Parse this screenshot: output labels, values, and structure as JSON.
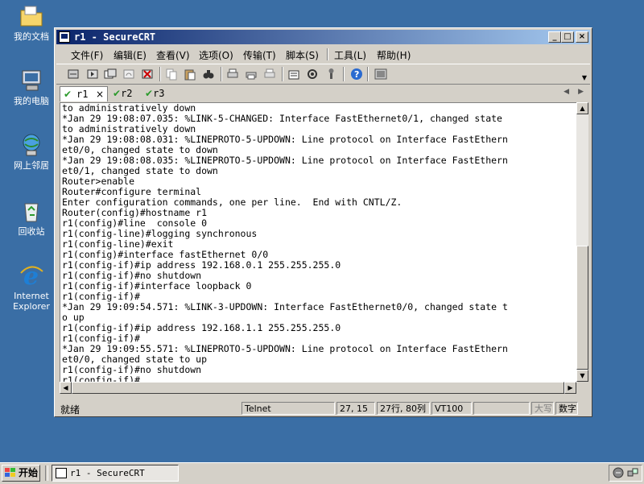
{
  "desktop": {
    "icons": [
      {
        "label": "我的文档",
        "icon": "folder-icon"
      },
      {
        "label": "我的电脑",
        "icon": "computer-icon"
      },
      {
        "label": "网上邻居",
        "icon": "network-icon"
      },
      {
        "label": "回收站",
        "icon": "recycle-bin-icon"
      },
      {
        "label": "Internet Explorer",
        "icon": "ie-icon"
      }
    ]
  },
  "window": {
    "title": "r1 - SecureCRT",
    "controls": {
      "minimize": "_",
      "maximize": "□",
      "close": "×"
    }
  },
  "menu": [
    "文件(F)",
    "编辑(E)",
    "查看(V)",
    "选项(O)",
    "传输(T)",
    "脚本(S)",
    "工具(L)",
    "帮助(H)"
  ],
  "tabs": [
    {
      "label": "r1",
      "active": true,
      "close": "×"
    },
    {
      "label": "r2",
      "active": false
    },
    {
      "label": "r3",
      "active": false
    }
  ],
  "tab_nav": {
    "prev": "◀",
    "next": "▶"
  },
  "terminal": {
    "lines": [
      "to administratively down",
      "*Jan 29 19:08:07.035: %LINK-5-CHANGED: Interface FastEthernet0/1, changed state",
      "to administratively down",
      "*Jan 29 19:08:08.031: %LINEPROTO-5-UPDOWN: Line protocol on Interface FastEthern",
      "et0/0, changed state to down",
      "*Jan 29 19:08:08.035: %LINEPROTO-5-UPDOWN: Line protocol on Interface FastEthern",
      "et0/1, changed state to down",
      "Router>enable",
      "Router#configure terminal",
      "Enter configuration commands, one per line.  End with CNTL/Z.",
      "Router(config)#hostname r1",
      "r1(config)#line  console 0",
      "r1(config-line)#logging synchronous",
      "r1(config-line)#exit",
      "r1(config)#interface fastEthernet 0/0",
      "r1(config-if)#ip address 192.168.0.1 255.255.255.0",
      "r1(config-if)#no shutdown",
      "r1(config-if)#interface loopback 0",
      "r1(config-if)#",
      "*Jan 29 19:09:54.571: %LINK-3-UPDOWN: Interface FastEthernet0/0, changed state t",
      "o up",
      "r1(config-if)#ip address 192.168.1.1 255.255.255.0",
      "r1(config-if)#",
      "*Jan 29 19:09:55.571: %LINEPROTO-5-UPDOWN: Line protocol on Interface FastEthern",
      "et0/0, changed state to up",
      "r1(config-if)#no shutdown",
      "r1(config-if)#"
    ]
  },
  "status": {
    "ready": "就绪",
    "protocol": "Telnet",
    "cursor": "27, 15",
    "size": "27行, 80列",
    "emulation": "VT100",
    "caps": "大写",
    "num": "数字"
  },
  "taskbar": {
    "start": "开始",
    "task": "r1 - SecureCRT"
  }
}
